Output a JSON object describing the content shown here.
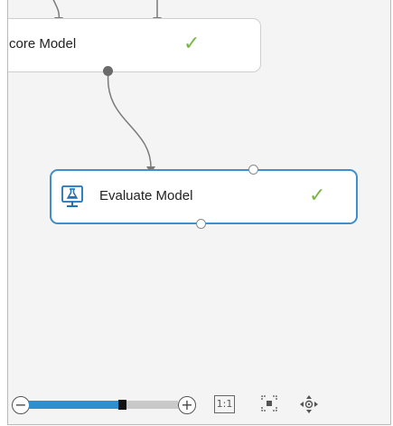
{
  "modules": {
    "score": {
      "label": "core Model",
      "status": "completed"
    },
    "evaluate": {
      "label": "Evaluate Model",
      "status": "completed",
      "selected": true
    }
  },
  "zoom": {
    "zoom_out_glyph": "−",
    "zoom_in_glyph": "+",
    "level_fraction": 0.6,
    "actual_size_label": "1:1",
    "fit_icon": "fit-to-screen-icon",
    "pan_icon": "pan-icon"
  },
  "colors": {
    "selected_border": "#3f8fce",
    "status_check": "#7ab648",
    "zoom_fill": "#2e8fd0"
  },
  "icons": {
    "completed": "✓",
    "evaluate": "flask-monitor-icon"
  }
}
